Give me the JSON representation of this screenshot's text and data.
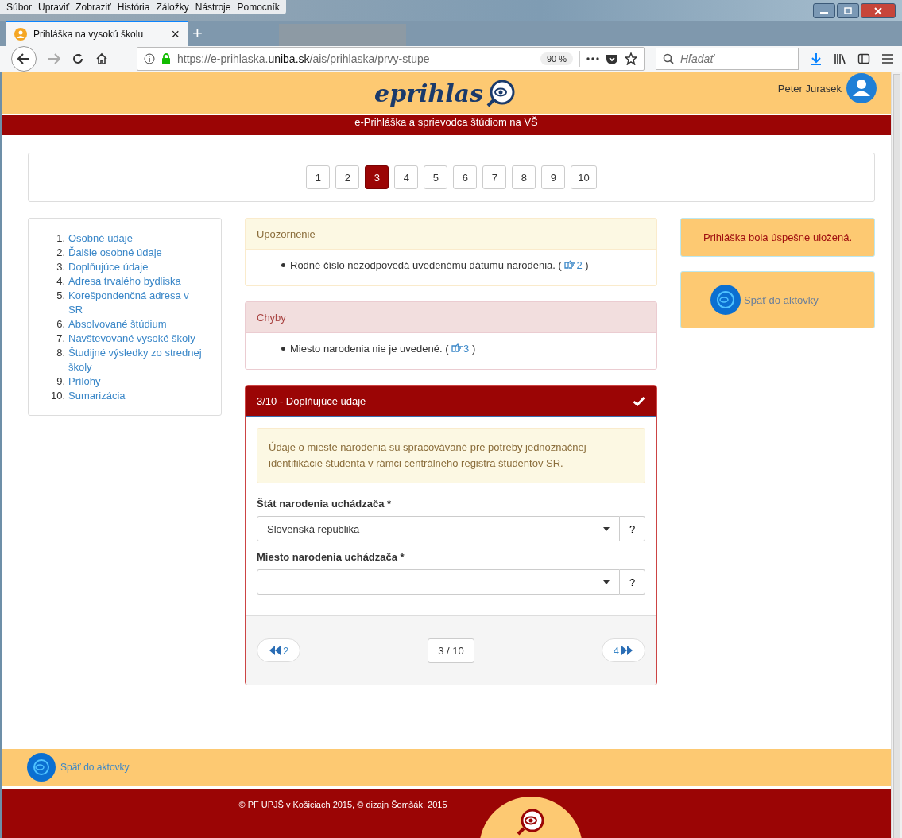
{
  "browser": {
    "menu": [
      "Súbor",
      "Upraviť",
      "Zobraziť",
      "História",
      "Záložky",
      "Nástroje",
      "Pomocník"
    ],
    "tab": {
      "title": "Prihláška na vysokú školu",
      "close": "×"
    },
    "new_tab": "+",
    "url": {
      "prefix": "https://e-prihlaska.",
      "domain": "uniba.sk",
      "path": "/ais/prihlaska/prvy-stupe"
    },
    "zoom": "90 %",
    "search": {
      "placeholder": "Hľadať"
    }
  },
  "header": {
    "logo": "eprihlas",
    "user": "Peter Jurasek",
    "subtitle": "e-Prihláška a sprievodca štúdiom na VŠ"
  },
  "pager": [
    {
      "label": "1",
      "selected": false
    },
    {
      "label": "2",
      "selected": false
    },
    {
      "label": "3",
      "selected": true
    },
    {
      "label": "4",
      "selected": false
    },
    {
      "label": "5",
      "selected": false
    },
    {
      "label": "6",
      "selected": false
    },
    {
      "label": "7",
      "selected": false
    },
    {
      "label": "8",
      "selected": false
    },
    {
      "label": "9",
      "selected": false
    },
    {
      "label": "10",
      "selected": false
    }
  ],
  "steps": [
    {
      "number": "1.",
      "label": "Osobné údaje"
    },
    {
      "number": "2.",
      "label": "Ďalšie osobné údaje"
    },
    {
      "number": "3.",
      "label": "Doplňujúce údaje"
    },
    {
      "number": "4.",
      "label": "Adresa trvalého bydliska"
    },
    {
      "number": "5.",
      "label": "Korešpondenčná adresa v SR"
    },
    {
      "number": "6.",
      "label": "Absolvované štúdium"
    },
    {
      "number": "7.",
      "label": "Navštevované vysoké školy"
    },
    {
      "number": "8.",
      "label": "Študijné výsledky zo strednej školy"
    },
    {
      "number": "9.",
      "label": "Prílohy"
    },
    {
      "number": "10.",
      "label": "Sumarizácia"
    }
  ],
  "alerts": [
    {
      "kind": "warning",
      "title": "Upozornenie",
      "items": [
        {
          "text": "Rodné číslo nezodpovedá uvedenému dátumu narodenia. (",
          "link": "2",
          "suffix": ")"
        }
      ]
    },
    {
      "kind": "error",
      "title": "Chyby",
      "items": [
        {
          "text": "Miesto narodenia nie je uvedené. (",
          "link": "3",
          "suffix": ")"
        }
      ]
    }
  ],
  "form": {
    "title": "3/10 - Doplňujúce údaje",
    "complete": true,
    "notice": "Údaje o mieste narodenia sú spracovávané pre potreby jednoznačnej identifikácie študenta v rámci centrálneho registra študentov SR.",
    "fields": [
      {
        "label": "Štát narodenia uchádzača *",
        "value": "Slovenská republika",
        "help": "?"
      },
      {
        "label": "Miesto narodenia uchádzača *",
        "help": "?"
      }
    ],
    "prev": "2",
    "page": "3 / 10",
    "next": "4"
  },
  "save_message": "Prihláška bola úspešne uložená.",
  "back_link": "Späť do aktovky",
  "footer": {
    "back_link": "Späť do aktovky",
    "copyright": "© PF UPJŠ v Košiciach 2015, © dizajn Šomšák, 2015"
  }
}
